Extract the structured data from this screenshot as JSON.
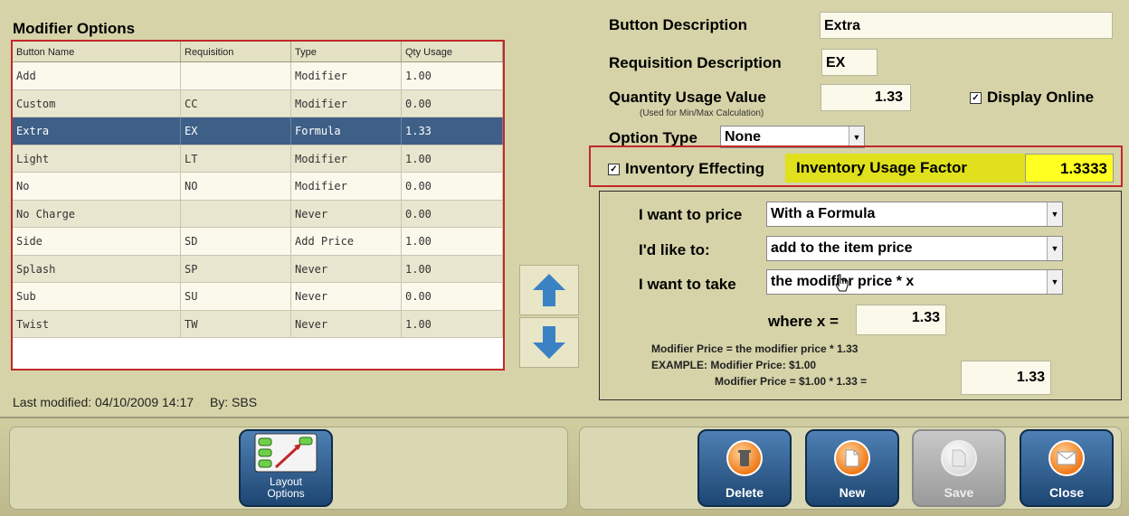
{
  "left": {
    "title": "Modifier Options",
    "columns": [
      "Button Name",
      "Requisition",
      "Type",
      "Qty Usage"
    ],
    "rows": [
      [
        "Add",
        "",
        "Modifier",
        "1.00"
      ],
      [
        "Custom",
        "CC",
        "Modifier",
        "0.00"
      ],
      [
        "Extra",
        "EX",
        "Formula",
        "1.33"
      ],
      [
        "Light",
        "LT",
        "Modifier",
        "1.00"
      ],
      [
        "No",
        "NO",
        "Modifier",
        "0.00"
      ],
      [
        "No Charge",
        "",
        "Never",
        "0.00"
      ],
      [
        "Side",
        "SD",
        "Add Price",
        "1.00"
      ],
      [
        "Splash",
        "SP",
        "Never",
        "1.00"
      ],
      [
        "Sub",
        "SU",
        "Never",
        "0.00"
      ],
      [
        "Twist",
        "TW",
        "Never",
        "1.00"
      ]
    ],
    "selected_index": 2,
    "last_modified": "Last modified: 04/10/2009 14:17",
    "by": "By: SBS"
  },
  "right": {
    "button_description_label": "Button Description",
    "button_description_value": "Extra",
    "requisition_label": "Requisition Description",
    "requisition_value": "EX",
    "qty_usage_label": "Quantity Usage Value",
    "qty_usage_note": "(Used for Min/Max Calculation)",
    "qty_usage_value": "1.33",
    "display_online_label": "Display Online",
    "option_type_label": "Option Type",
    "option_type_value": "None",
    "inventory_effecting_label": "Inventory Effecting",
    "inventory_usage_factor_label": "Inventory Usage Factor",
    "inventory_usage_factor_value": "1.3333",
    "price": {
      "want_to_price_label": "I want to price",
      "want_to_price_value": "With a Formula",
      "like_to_label": "I'd like to:",
      "like_to_value": "add to the item price",
      "want_to_take_label": "I want to take",
      "want_to_take_value": "the modifier price * x",
      "where_x_label": "where x =",
      "where_x_value": "1.33",
      "explain1": "Modifier Price = the modifier price * 1.33",
      "explain2": "EXAMPLE: Modifier Price: $1.00",
      "explain3": "Modifier Price = $1.00 * 1.33 =",
      "result_value": "1.33"
    }
  },
  "toolbar": {
    "layout_options_line1": "Layout",
    "layout_options_line2": "Options",
    "delete_label": "Delete",
    "new_label": "New",
    "save_label": "Save",
    "close_label": "Close"
  },
  "colors": {
    "background": "#d6d3a8",
    "selected_row": "#3e5f86",
    "highlight_frame": "#c0282a",
    "usage_factor_label": "#e0e01c",
    "usage_factor_value": "#ffff22",
    "button_blue": "#1d4672",
    "arrow_blue": "#3b82c4",
    "orb_orange": "#f07a1a"
  },
  "icons": {
    "up": "arrow-up-icon",
    "down": "arrow-down-icon",
    "layout": "layout-options-icon",
    "delete": "trash-icon",
    "new": "new-document-icon",
    "save": "save-icon",
    "close": "envelope-icon",
    "checkbox": "checkbox-checked-icon",
    "dropdown": "chevron-down-icon"
  }
}
